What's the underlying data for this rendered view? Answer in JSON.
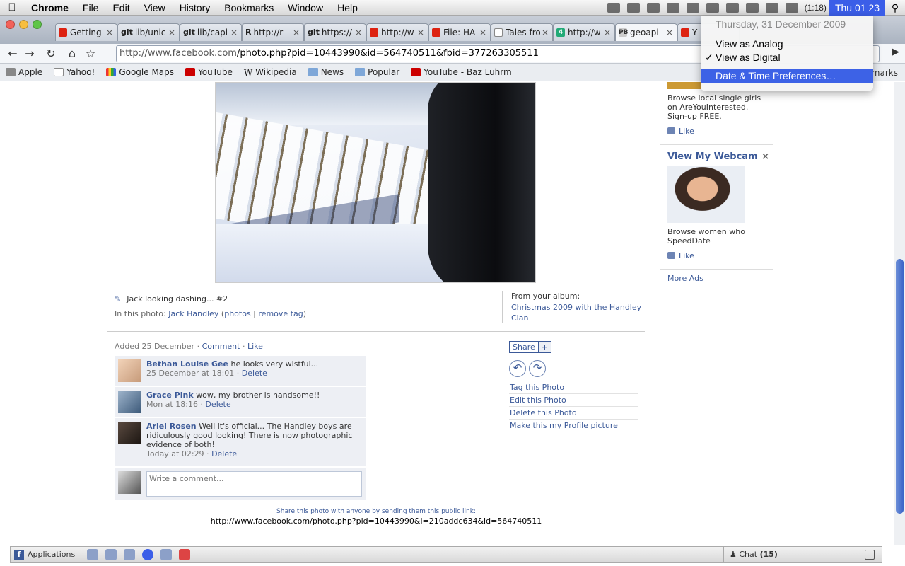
{
  "menubar": {
    "app": "Chrome",
    "items": [
      "File",
      "Edit",
      "View",
      "History",
      "Bookmarks",
      "Window",
      "Help"
    ],
    "battery": "(1:18)",
    "clock": "Thu 01 23"
  },
  "clock_menu": {
    "date": "Thursday, 31 December 2009",
    "items": [
      "View as Analog",
      "View as Digital",
      "Date & Time Preferences…"
    ],
    "checked_item": "View as Digital",
    "highlighted_item": "Date & Time Preferences…"
  },
  "tabs": [
    {
      "label": "Getting",
      "icon": "red-square-icon"
    },
    {
      "label": "lib/unic",
      "icon": "git-icon",
      "prefix": "git"
    },
    {
      "label": "lib/capi",
      "icon": "git-icon",
      "prefix": "git"
    },
    {
      "label": "http://r",
      "icon": "r-icon",
      "prefix": "R"
    },
    {
      "label": "https://",
      "icon": "git-icon",
      "prefix": "git"
    },
    {
      "label": "http://w",
      "icon": "youtube-icon"
    },
    {
      "label": "File: HA",
      "icon": "red-square-icon"
    },
    {
      "label": "Tales fro",
      "icon": "page-icon"
    },
    {
      "label": "http://w",
      "icon": "channel4-icon",
      "prefix": "4"
    },
    {
      "label": "geoapi",
      "icon": "pb-icon",
      "prefix": "PB"
    },
    {
      "label": "Y",
      "icon": "red-square-icon"
    }
  ],
  "toolbar": {
    "url_host": "http://www.facebook.com",
    "url_path": "/photo.php?pid=10443990&id=564740511&fbid=377263305511"
  },
  "bookmarks": [
    {
      "label": "Apple",
      "icon": "apple"
    },
    {
      "label": "Yahoo!",
      "icon": "page"
    },
    {
      "label": "Google Maps",
      "icon": "google"
    },
    {
      "label": "YouTube",
      "icon": "yt"
    },
    {
      "label": "Wikipedia",
      "icon": "wiki"
    },
    {
      "label": "News",
      "icon": "folder"
    },
    {
      "label": "Popular",
      "icon": "folder"
    },
    {
      "label": "YouTube - Baz Luhrm",
      "icon": "yt"
    }
  ],
  "bookmarks_overflow": "kmarks",
  "photo": {
    "caption": "Jack looking dashing... #2",
    "in_photo_label": "In this photo:",
    "person": "Jack Handley",
    "photos_link": "photos",
    "remove_tag": "remove tag",
    "album_label": "From your album:",
    "album_name": "Christmas 2009 with the Handley Clan"
  },
  "added": {
    "text": "Added 25 December",
    "comment": "Comment",
    "like": "Like"
  },
  "comments": [
    {
      "name": "Bethan Louise Gee",
      "text": "he looks very wistful...",
      "time": "25 December at 18:01",
      "delete": "Delete"
    },
    {
      "name": "Grace Pink",
      "text": "wow, my brother is handsome!!",
      "time": "Mon at 18:16",
      "delete": "Delete"
    },
    {
      "name": "Ariel Rosen",
      "text": "Well it's official... The Handley boys are ridiculously good looking! There is now photographic evidence of both!",
      "time": "Today at 02:29",
      "delete": "Delete"
    }
  ],
  "write_comment_placeholder": "Write a comment...",
  "actions": {
    "share": "Share",
    "share_plus": "+",
    "links": [
      "Tag this Photo",
      "Edit this Photo",
      "Delete this Photo",
      "Make this my Profile picture"
    ]
  },
  "public_link": {
    "label": "Share this photo with anyone by sending them this public link:",
    "url": "http://www.facebook.com/photo.php?pid=10443990&l=210addc634&id=564740511"
  },
  "ads": {
    "ad1_text": "Browse local single girls on AreYouInterested. Sign-up FREE.",
    "ad1_like": "Like",
    "ad2_title": "View My Webcam",
    "ad2_close": "×",
    "ad2_text": "Browse women who SpeedDate",
    "ad2_like": "Like",
    "more_ads": "More Ads"
  },
  "chatbar": {
    "applications": "Applications",
    "chat_label": "Chat",
    "chat_count": "(15)"
  }
}
